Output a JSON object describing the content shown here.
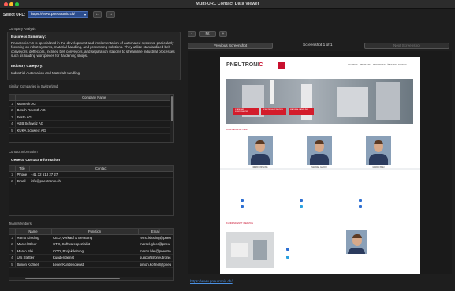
{
  "window": {
    "title": "Multi-URL Contact Data Viewer"
  },
  "url_bar": {
    "label": "Select URL:",
    "selected_url": "https://www.pneutronic.ch/",
    "back": "←",
    "forward": "→"
  },
  "company_analysis": {
    "section_title": "Company Analysis",
    "business_summary_heading": "Business Summary:",
    "business_summary": "Pneutronic AG is specialized in the development and implementation of automated systems, particularly focusing on robot systems, material handling, and processing solutions. They utilize standardized belt conveyors, deflectors, inclined belt conveyors, and separation stations to streamline industrial processes such as loading workpieces for hardening shops.",
    "industry_heading": "Industry Category:",
    "industry": "Industrial Automation and Material Handling"
  },
  "similar_companies": {
    "section_title": "Similar Companies in Switzerland",
    "column": "Company Name",
    "rows": [
      "Mantech AG",
      "Bosch Rexroth AG",
      "Festo AG",
      "ABB Schweiz AG",
      "KUKA Schweiz AG"
    ]
  },
  "contact_info": {
    "section_title": "Contact Information",
    "general_heading": "General Contact Information",
    "columns": [
      "Title",
      "Contact"
    ],
    "rows": [
      {
        "title": "Phone",
        "contact": "+41 32 613 27 27"
      },
      {
        "title": "Email",
        "contact": "info@pneutronic.ch"
      }
    ]
  },
  "team": {
    "section_title": "Team Members",
    "columns": [
      "Name",
      "Function",
      "Email"
    ],
    "rows": [
      {
        "name": "Remo Kissling",
        "function": "CEO, Verkauf & Beratung",
        "email": "remo.kissling@pneu"
      },
      {
        "name": "Marcel Gloor",
        "function": "CTO, Softwarespezialist",
        "email": "marcel.gloor@pneu"
      },
      {
        "name": "Marco Blei",
        "function": "COO, Projektleitung",
        "email": "marco.blei@pneutro"
      },
      {
        "name": "Urs Stettler",
        "function": "Kundendienst",
        "email": "support@pneutronic"
      },
      {
        "name": "Simon Kofmel",
        "function": "Leiter Kundendienst",
        "email": "simon.kofmel@pneu"
      }
    ]
  },
  "screenshot_panel": {
    "zoom": "Fit",
    "prev_label": "Previous Screenshot",
    "counter": "Screenshot 1 of 1",
    "next_label": "Next Screenshot",
    "link": "https://www.pneutronic.ch/"
  },
  "website": {
    "logo_main": "PNEUTRONI",
    "logo_accent": "C",
    "nav": [
      "ANGEBOTE",
      "PRODUKTE",
      "REFERENZEN",
      "ÜBER UNS",
      "KONTAKT"
    ],
    "cta": [
      "STANDARD KOMPONENTEN",
      "ROBOTER AUTOMATION",
      "MATERIAL HANDLING"
    ],
    "team_heading": "ANSPRECHPARTNER",
    "people": [
      "REMO KISSLING",
      "MARCEL GLOOR",
      "MARCO BLEI"
    ],
    "second_heading": "KUNDENDIENST / SERVICE"
  },
  "colors": {
    "accent": "#2b4c8c",
    "brand_red": "#c8102e",
    "link": "#4a90e2"
  }
}
